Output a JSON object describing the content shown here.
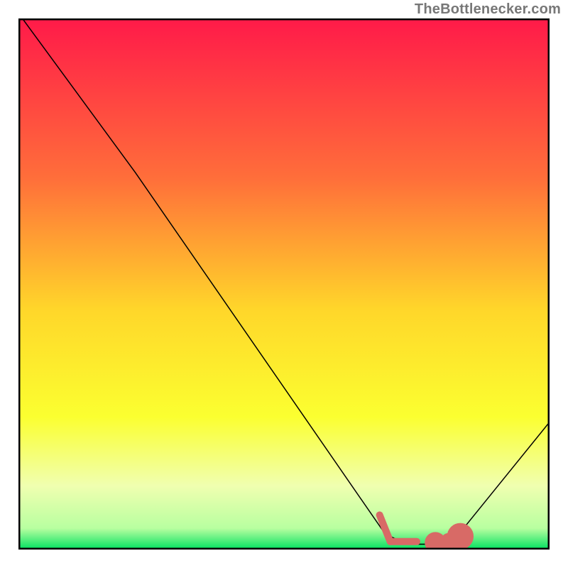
{
  "watermark": "TheBottlenecker.com",
  "chart_data": {
    "type": "line",
    "title": "",
    "xlabel": "",
    "ylabel": "",
    "xlim": [
      0,
      100
    ],
    "ylim": [
      0,
      100
    ],
    "gradient_stops": [
      {
        "offset": 0,
        "color": "#ff1a49"
      },
      {
        "offset": 30,
        "color": "#ff6e3a"
      },
      {
        "offset": 55,
        "color": "#ffd72a"
      },
      {
        "offset": 75,
        "color": "#fbff30"
      },
      {
        "offset": 88,
        "color": "#f0ffb0"
      },
      {
        "offset": 96,
        "color": "#b8ffa0"
      },
      {
        "offset": 100,
        "color": "#00e060"
      }
    ],
    "series": [
      {
        "name": "bottleneck-curve",
        "color": "#000000",
        "stroke_width": 1.5,
        "points": [
          {
            "x": 0,
            "y": 101
          },
          {
            "x": 22,
            "y": 71
          },
          {
            "x": 69,
            "y": 3
          },
          {
            "x": 73,
            "y": 1
          },
          {
            "x": 79,
            "y": 1
          },
          {
            "x": 83,
            "y": 3
          },
          {
            "x": 100,
            "y": 24
          }
        ]
      }
    ],
    "marker_color": "#d86a66",
    "marker_segments": [
      {
        "type": "line",
        "x1": 68,
        "y1": 6.5,
        "x2": 70,
        "y2": 1.5
      },
      {
        "type": "line",
        "x1": 70,
        "y1": 1.5,
        "x2": 75,
        "y2": 1.5
      },
      {
        "type": "dot",
        "x": 78.5,
        "y": 1.3,
        "r": 2.0
      },
      {
        "type": "dot",
        "x": 81,
        "y": 1.6,
        "r": 1.5
      },
      {
        "type": "dot",
        "x": 83.2,
        "y": 2.5,
        "r": 2.5
      }
    ]
  }
}
